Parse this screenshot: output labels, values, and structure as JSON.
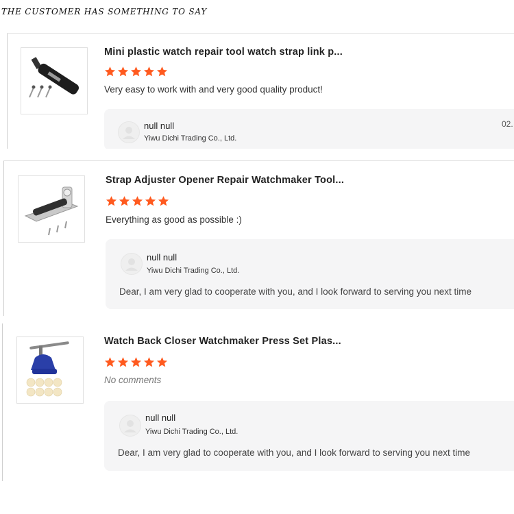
{
  "page": {
    "heading": "THE CUSTOMER HAS SOMETHING TO SAY"
  },
  "colors": {
    "star": "#ff5a1f",
    "reply_bg": "#f5f5f6"
  },
  "reviews": [
    {
      "product_title": "Mini plastic watch repair tool watch strap link p...",
      "rating": 5,
      "comment": "Very easy to work with and very good quality product!",
      "reply": {
        "name": "null null",
        "store": "Yiwu Dichi Trading Co., Ltd.",
        "date": "02.",
        "text": ""
      }
    },
    {
      "product_title": "Strap Adjuster Opener Repair Watchmaker Tool...",
      "rating": 5,
      "comment": "Everything as good as possible :)",
      "reply": {
        "name": "null null",
        "store": "Yiwu Dichi Trading Co., Ltd.",
        "text": "Dear, I am very glad to cooperate with you, and I look forward to serving you next time"
      }
    },
    {
      "product_title": "Watch Back Closer Watchmaker Press Set Plas...",
      "rating": 5,
      "comment": "No comments",
      "reply": {
        "name": "null null",
        "store": "Yiwu Dichi Trading Co., Ltd.",
        "text": "Dear, I am very glad to cooperate with you, and I look forward to serving you next time"
      }
    }
  ]
}
